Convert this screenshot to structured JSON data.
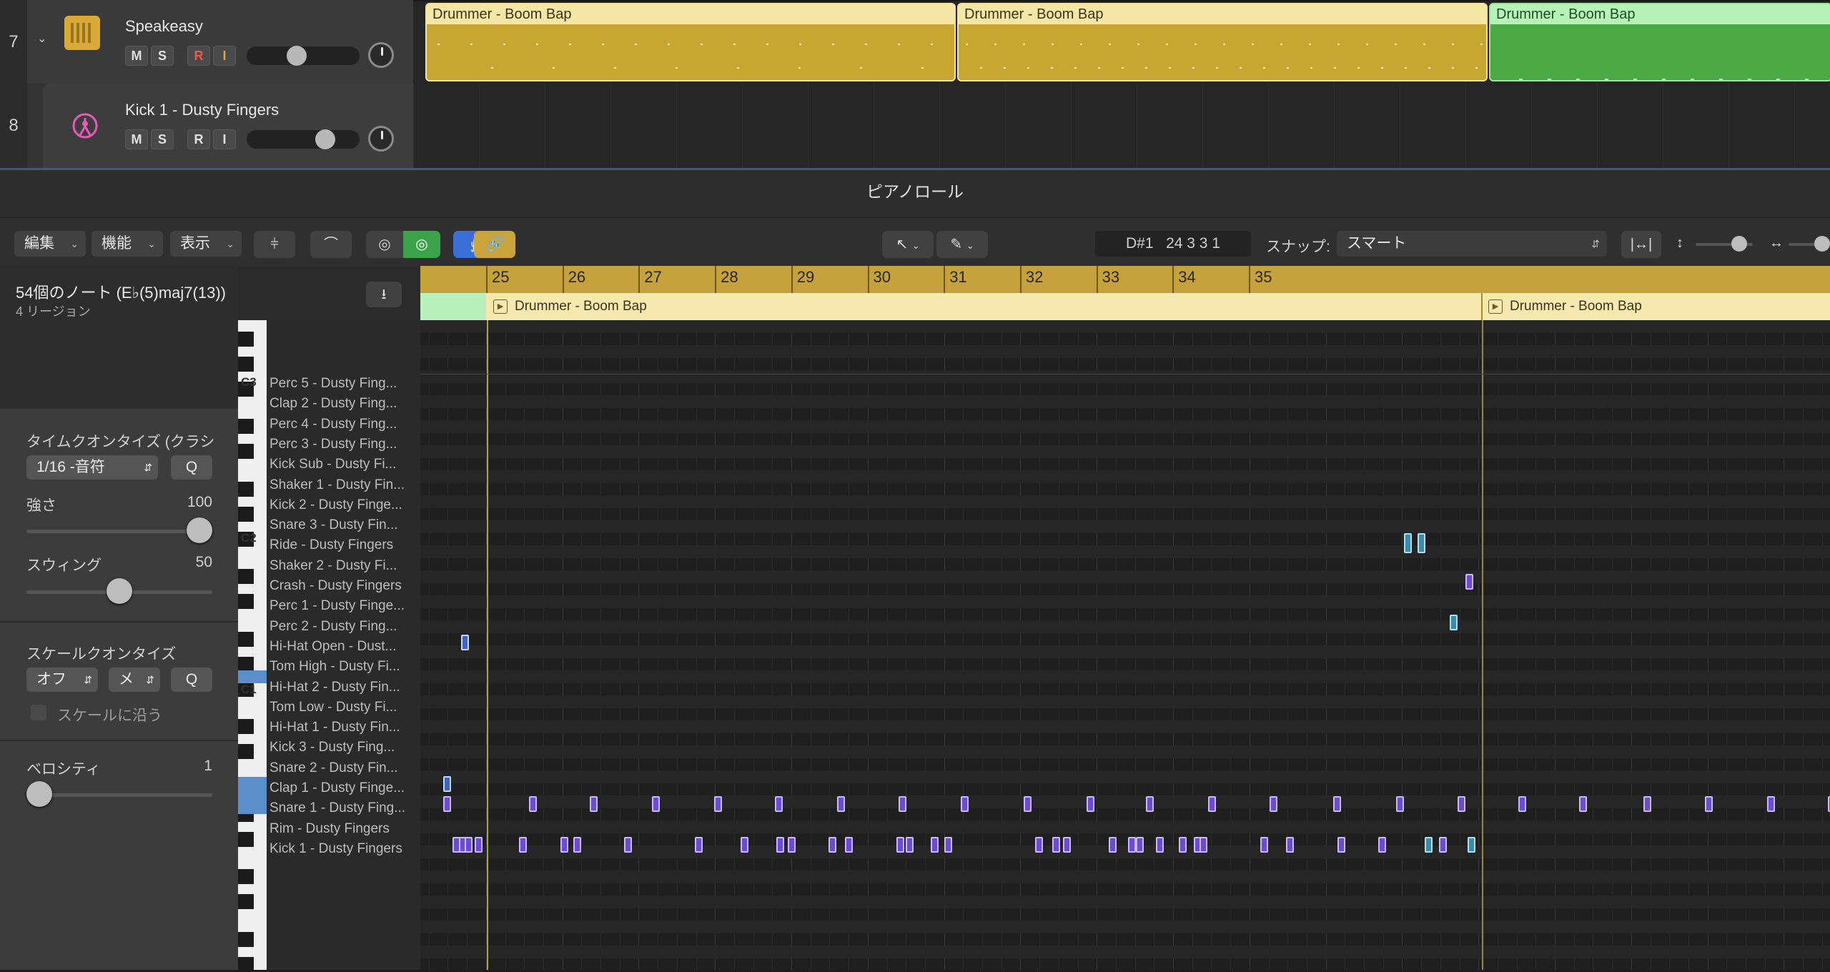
{
  "tracks": [
    {
      "number": "7",
      "name": "Speakeasy",
      "buttons": [
        "M",
        "S",
        "R",
        "I"
      ]
    },
    {
      "number": "8",
      "name": "Kick 1 - Dusty Fingers",
      "buttons": [
        "M",
        "S",
        "R",
        "I"
      ]
    }
  ],
  "regions": [
    {
      "title": "Drummer - Boom Bap"
    },
    {
      "title": "Drummer - Boom Bap"
    },
    {
      "title": "Drummer - Boom Bap"
    }
  ],
  "editor": {
    "title": "ピアノロール",
    "menus": [
      "編集",
      "機能",
      "表示"
    ],
    "position_note": "D#1",
    "position_value": "24 3 3 1",
    "snap_label": "スナップ:",
    "snap_value": "スマート"
  },
  "info": {
    "note_count": "54個のノート (E♭(5)maj7(13))",
    "region_count": "4 リージョン"
  },
  "inspector": {
    "time_quantize_label": "タイムクオンタイズ (クラシ",
    "time_quantize_value": "1/16 -音符",
    "q_label": "Q",
    "strength_label": "強さ",
    "strength_value": "100",
    "strength_level": 1.0,
    "swing_label": "スウィング",
    "swing_value": "50",
    "swing_level": 0.5,
    "scale_quantize_label": "スケールクオンタイズ",
    "scale_off": "オフ",
    "scale_mode": "メ",
    "follow_scale_label": "スケールに沿う",
    "velocity_label": "ベロシティ",
    "velocity_value": "1",
    "velocity_level": 0.0
  },
  "ruler": {
    "bars": [
      "25",
      "26",
      "27",
      "28",
      "29",
      "30",
      "31",
      "32",
      "33",
      "34",
      "35"
    ],
    "regions": [
      "Drummer - Boom Bap",
      "Drummer - Boom Bap"
    ]
  },
  "keyboard_labels": [
    "C3",
    "C2",
    "C1"
  ],
  "drum_names": [
    "Perc 5 - Dusty Fing...",
    "Clap 2 - Dusty Fing...",
    "Perc 4 - Dusty Fing...",
    "Perc 3 - Dusty Fing...",
    "Kick Sub - Dusty Fi...",
    "Shaker 1 - Dusty Fin...",
    "Kick 2 - Dusty Finge...",
    "Snare 3 - Dusty Fin...",
    "Ride - Dusty Fingers",
    "Shaker 2 - Dusty Fi...",
    "Crash - Dusty Fingers",
    "Perc 1 - Dusty Finge...",
    "Perc 2 - Dusty Fing...",
    "Hi-Hat Open - Dust...",
    "Tom High - Dusty Fi...",
    "Hi-Hat 2 - Dusty Fin...",
    "Tom Low - Dusty Fi...",
    "Hi-Hat 1 - Dusty Fin...",
    "Kick 3 - Dusty Fing...",
    "Snare 2 - Dusty Fin...",
    "Clap 1 - Dusty Finge...",
    "Snare 1 - Dusty Fing...",
    "Rim - Dusty Fingers",
    "Kick 1 - Dusty Fingers"
  ],
  "colors": {
    "region_gold": "#c8a632",
    "region_green": "#4caa45",
    "note_purple": "#6b4ccf",
    "note_teal": "#3f8aa6",
    "accent_blue": "#3a6fd8",
    "ruler_gold": "#c5a23b"
  }
}
